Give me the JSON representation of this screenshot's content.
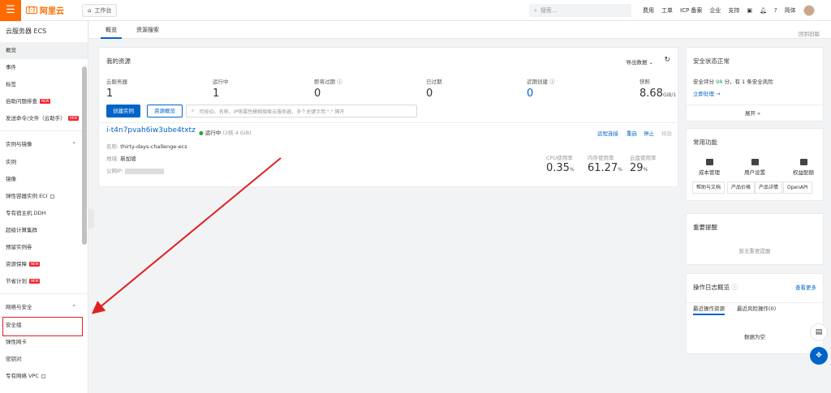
{
  "topbar": {
    "menu_icon": "hamburger-icon",
    "brand": "阿里云",
    "brand_mark": "[-]",
    "workbench": "工作台",
    "search_placeholder": "搜索...",
    "links": [
      "费用",
      "工单",
      "ICP 备案",
      "企业",
      "支持"
    ],
    "lang": "简体",
    "accent": "#ff6a00"
  },
  "sidebar": {
    "title": "云服务器 ECS",
    "items_top": [
      {
        "label": "概览",
        "active": true
      },
      {
        "label": "事件"
      },
      {
        "label": "标签"
      },
      {
        "label": "自助问题排查",
        "badge": "NEW"
      },
      {
        "label": "发送命令/文件（云助手）",
        "badge": "NEW"
      }
    ],
    "group1": "实例与镜像",
    "items_g1": [
      {
        "label": "实例"
      },
      {
        "label": "镜像"
      },
      {
        "label": "弹性容器实例 ECI",
        "ext": true
      },
      {
        "label": "专有宿主机 DDH"
      },
      {
        "label": "超级计算集群"
      },
      {
        "label": "预留实例券"
      },
      {
        "label": "资源保障",
        "badge": "NEW"
      },
      {
        "label": "节省计划",
        "badge": "NEW"
      }
    ],
    "group2": "网络与安全",
    "items_g2": [
      {
        "label": "安全组"
      },
      {
        "label": "弹性网卡"
      },
      {
        "label": "密钥对"
      },
      {
        "label": "专有网络 VPC",
        "ext": true
      }
    ]
  },
  "tabs": {
    "items": [
      "概览",
      "资源搜索"
    ],
    "back_old": "回到旧版"
  },
  "resources": {
    "title": "我的资源",
    "export": "导出数据",
    "stats": [
      {
        "label": "云服务器",
        "value": "1"
      },
      {
        "label": "运行中",
        "value": "1"
      },
      {
        "label": "即将过期",
        "value": "0",
        "help": true
      },
      {
        "label": "已过期",
        "value": "0"
      },
      {
        "label": "近期创建",
        "value": "0",
        "help": true,
        "link": true
      },
      {
        "label": "快照",
        "value": "8.68",
        "unit": "GiB/1"
      }
    ],
    "create_button": "创建实例",
    "overview_button": "资源概览",
    "filter_placeholder": "可按ID、名称、IP等属性模糊搜索云服务器，多个关键字用 \",\" 隔开"
  },
  "instance": {
    "id": "i-t4n7pvah6iw3ube4txtz",
    "status": "运行中",
    "spec": "(2核 4 GiB)",
    "name_label": "名称:",
    "name": "thirty-days-challenge-ecs",
    "region_label": "地域:",
    "region": "新加坡",
    "ip_label": "公网IP:",
    "actions": [
      "远程连接",
      "重启",
      "停止",
      "释放"
    ],
    "usage": [
      {
        "label": "CPU使用率",
        "value": "0.35",
        "unit": "%"
      },
      {
        "label": "内存使用率",
        "value": "61.27",
        "unit": "%"
      },
      {
        "label": "云盘使用率",
        "value": "29",
        "unit": "%"
      }
    ]
  },
  "security": {
    "title": "安全状态正常",
    "score_prefix": "安全评分",
    "score": "98",
    "score_suffix": "分，有 1 条安全风险",
    "action": "立即处理",
    "expand": "展开"
  },
  "common": {
    "title": "常用功能",
    "funcs": [
      {
        "label": "成本管理",
        "icon": "cost-icon"
      },
      {
        "label": "用户设置",
        "icon": "user-icon"
      },
      {
        "label": "权益配额",
        "icon": "quota-icon"
      }
    ],
    "buttons": [
      "帮助与文档",
      "产品价格",
      "产品详情",
      "OpenAPI"
    ]
  },
  "notice": {
    "title": "重要提醒",
    "empty": "暂无重要提醒"
  },
  "oplog": {
    "title": "操作日志概览",
    "more": "查看更多",
    "tabs": [
      "最近操作资源",
      "最近风险操作(0)"
    ],
    "empty": "数据为空"
  }
}
